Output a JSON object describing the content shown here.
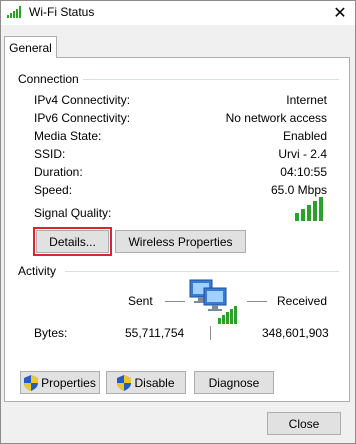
{
  "window": {
    "title": "Wi-Fi Status",
    "tab_label": "General",
    "close_button_label": "Close"
  },
  "connection": {
    "heading": "Connection",
    "rows": [
      {
        "label": "IPv4 Connectivity:",
        "value": "Internet"
      },
      {
        "label": "IPv6 Connectivity:",
        "value": "No network access"
      },
      {
        "label": "Media State:",
        "value": "Enabled"
      },
      {
        "label": "SSID:",
        "value": "Urvi - 2.4"
      },
      {
        "label": "Duration:",
        "value": "04:10:55"
      },
      {
        "label": "Speed:",
        "value": "65.0 Mbps"
      }
    ],
    "signal_quality_label": "Signal Quality:",
    "signal_bars": 5,
    "details_button": "Details...",
    "wireless_button": "Wireless Properties"
  },
  "activity": {
    "heading": "Activity",
    "sent_label": "Sent",
    "received_label": "Received",
    "bytes_label": "Bytes:",
    "bytes_sent": "55,711,754",
    "bytes_received": "348,601,903"
  },
  "actions": {
    "properties_label": "Properties",
    "disable_label": "Disable",
    "diagnose_label": "Diagnose"
  },
  "colors": {
    "signal_green": "#2e9e2e",
    "highlight_red": "#d9262c"
  }
}
